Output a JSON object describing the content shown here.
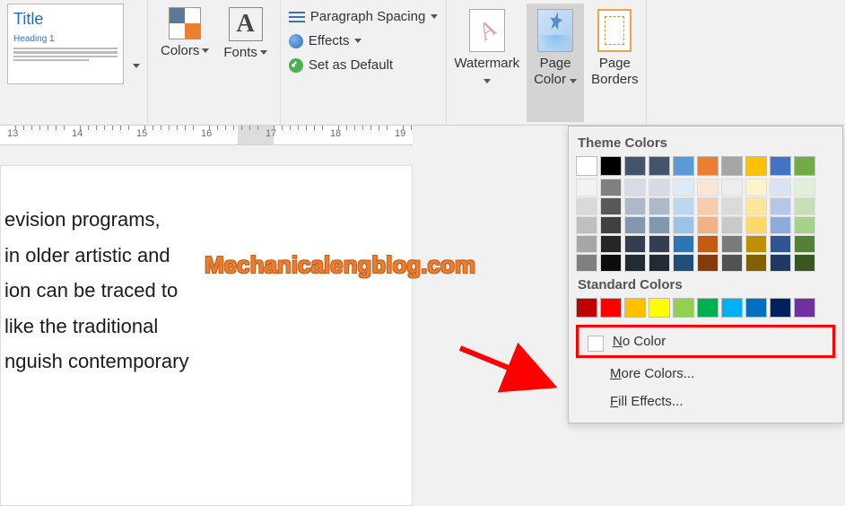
{
  "ribbon": {
    "title_preview": {
      "title": "Title",
      "heading": "Heading 1"
    },
    "colors_label": "Colors",
    "fonts_label": "Fonts",
    "paragraph_spacing": "Paragraph Spacing",
    "effects": "Effects",
    "set_default": "Set as Default",
    "watermark": "Watermark",
    "page_color": "Page\nColor",
    "page_borders": "Page\nBorders"
  },
  "ruler": {
    "marks": [
      "13",
      "14",
      "15",
      "16",
      "17",
      "18",
      "19"
    ]
  },
  "document": {
    "lines": [
      "evision programs,",
      "in older artistic and",
      "ion can be traced to",
      "like the traditional",
      "nguish contemporary"
    ]
  },
  "dropdown": {
    "theme_heading": "Theme Colors",
    "theme_main": [
      "#ffffff",
      "#000000",
      "#44546a",
      "#44546a",
      "#5b9bd5",
      "#ed7d31",
      "#a5a5a5",
      "#ffc000",
      "#4472c4",
      "#70ad47"
    ],
    "theme_shades": [
      [
        "#f2f2f2",
        "#d9d9d9",
        "#bfbfbf",
        "#a6a6a6",
        "#808080"
      ],
      [
        "#808080",
        "#595959",
        "#404040",
        "#262626",
        "#0d0d0d"
      ],
      [
        "#d6dce5",
        "#adb9ca",
        "#8497b0",
        "#333f50",
        "#222a35"
      ],
      [
        "#d6dce5",
        "#adb9ca",
        "#8497b0",
        "#333f50",
        "#222a35"
      ],
      [
        "#deebf7",
        "#bdd7ee",
        "#9dc3e6",
        "#2e75b6",
        "#1f4e79"
      ],
      [
        "#fbe5d6",
        "#f8cbad",
        "#f4b183",
        "#c55a11",
        "#843c0c"
      ],
      [
        "#ededed",
        "#dbdbdb",
        "#c9c9c9",
        "#7b7b7b",
        "#525252"
      ],
      [
        "#fff2cc",
        "#ffe699",
        "#ffd966",
        "#bf8f00",
        "#806000"
      ],
      [
        "#dae3f3",
        "#b4c7e7",
        "#8faadc",
        "#2f5597",
        "#203864"
      ],
      [
        "#e2f0d9",
        "#c5e0b4",
        "#a9d18e",
        "#548235",
        "#385723"
      ]
    ],
    "standard_heading": "Standard Colors",
    "standard_colors": [
      "#c00000",
      "#ff0000",
      "#ffc000",
      "#ffff00",
      "#92d050",
      "#00b050",
      "#00b0f0",
      "#0070c0",
      "#002060",
      "#7030a0"
    ],
    "no_color": "No Color",
    "more_colors": "More Colors...",
    "fill_effects": "Fill Effects..."
  },
  "overlay_text": "Mechanicalengblog.com"
}
